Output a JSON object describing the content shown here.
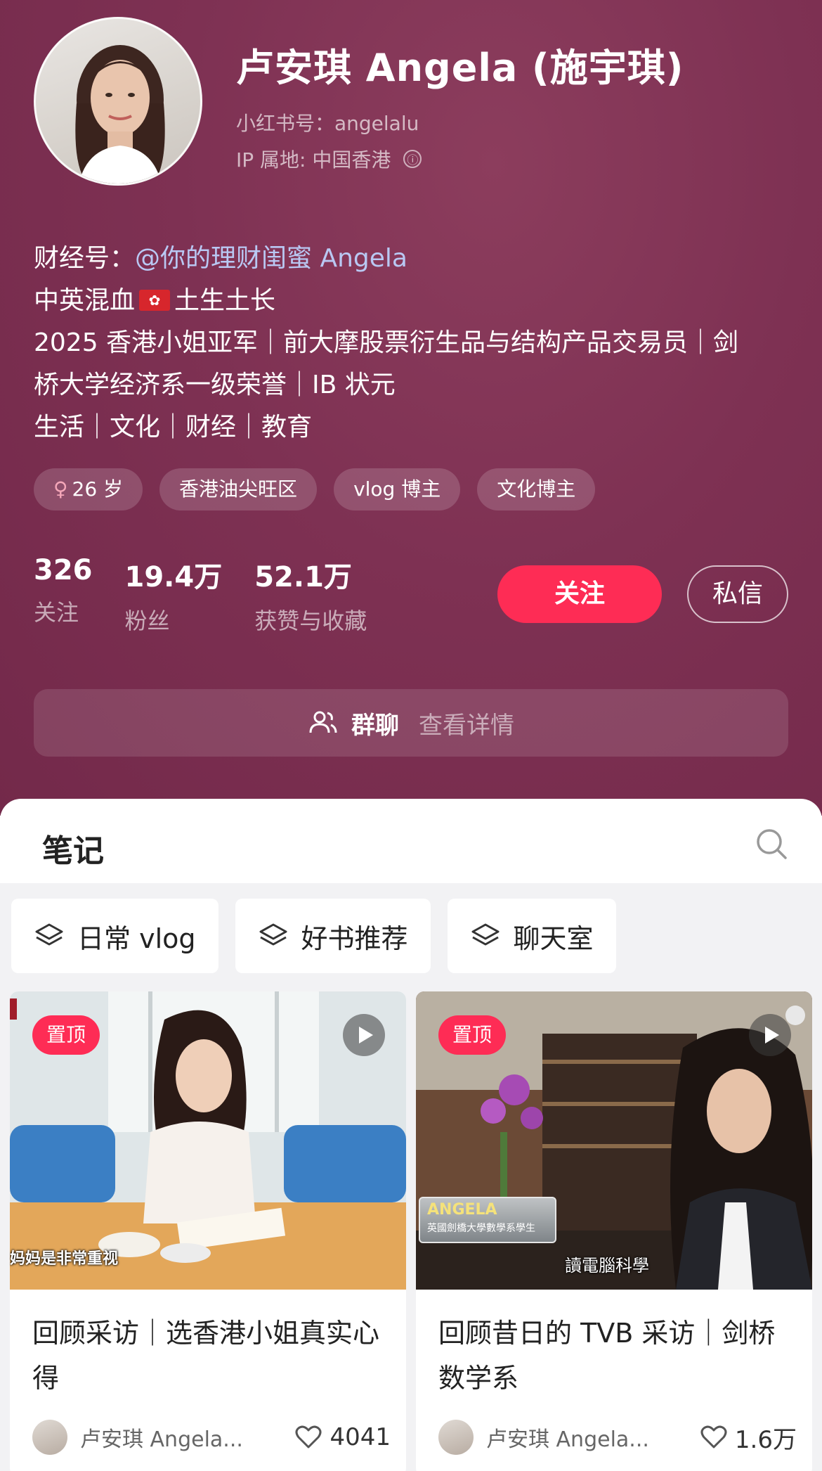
{
  "profile": {
    "name": "卢安琪 Angela (施宇琪)",
    "account_id": "小红书号：angelalu",
    "ip_location": "IP 属地: 中国香港",
    "info_icon": "ⓘ"
  },
  "bio": {
    "finance_prefix": "财经号：",
    "finance_link": "@你的理财闺蜜 Angela",
    "line2_a": "中英混血",
    "line2_b": "土生土长",
    "line3": "2025 香港小姐亚军｜前大摩股票衍生品与结构产品交易员｜剑",
    "line4": "桥大学经济系一级荣誉｜IB 状元",
    "line5": "生活｜文化｜财经｜教育"
  },
  "tags": [
    {
      "icon": "♀",
      "label": "26 岁"
    },
    {
      "label": "香港油尖旺区"
    },
    {
      "label": "vlog 博主"
    },
    {
      "label": "文化博主"
    }
  ],
  "stats": [
    {
      "value": "326",
      "label": "关注"
    },
    {
      "value": "19.4万",
      "label": "粉丝"
    },
    {
      "value": "52.1万",
      "label": "获赞与收藏"
    }
  ],
  "actions": {
    "follow": "关注",
    "message": "私信"
  },
  "group_chat": {
    "label": "群聊",
    "detail": "查看详情",
    "icon": "people-icon"
  },
  "notes_panel": {
    "title": "笔记",
    "icon": "search-icon"
  },
  "collections": [
    {
      "label": "日常 vlog",
      "icon": "layers-icon"
    },
    {
      "label": "好书推荐",
      "icon": "layers-icon"
    },
    {
      "label": "聊天室",
      "icon": "layers-icon"
    }
  ],
  "cards": [
    {
      "badge": "置顶",
      "video_caption": "妈妈是非常重视",
      "title": "回顾采访｜选香港小姐真实心得",
      "author": "卢安琪 Angela...",
      "likes": "4041"
    },
    {
      "badge": "置顶",
      "nameplate": "ANGELA",
      "nameplate_sub": "英國劍橋大學數學系學生",
      "video_caption": "讀電腦科學",
      "title": "回顾昔日的 TVB 采访｜剑桥数学系",
      "author": "卢安琪 Angela...",
      "likes": "1.6万"
    }
  ],
  "colors": {
    "accent": "#fe2c55",
    "header_bg": "#7e3153",
    "link": "#b9c8f3"
  }
}
